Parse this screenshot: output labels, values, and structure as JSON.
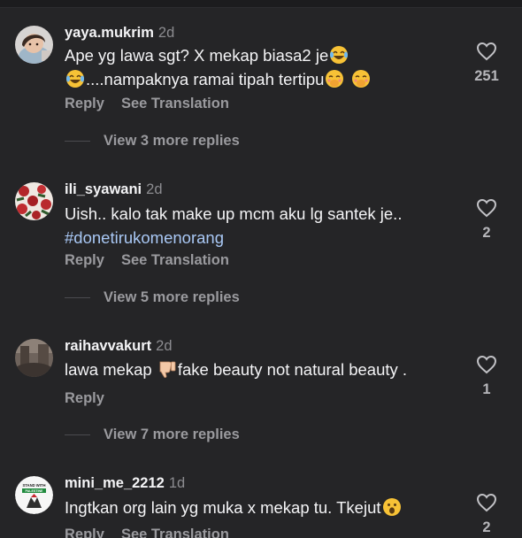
{
  "comments": [
    {
      "username": "yaya.mukrim",
      "time": "2d",
      "text_line1": "Ape yg lawa sgt? X mekap biasa2 je",
      "text_line2": "....nampaknya ramai tipah tertipu",
      "reply_label": "Reply",
      "translate_label": "See Translation",
      "like_count": "251",
      "more_replies": "View 3 more replies"
    },
    {
      "username": "ili_syawani",
      "time": "2d",
      "text_line1": "Uish.. kalo tak make up mcm aku lg santek je..",
      "hashtag": "#donetirukomenorang",
      "reply_label": "Reply",
      "translate_label": "See Translation",
      "like_count": "2",
      "more_replies": "View 5 more replies"
    },
    {
      "username": "raihavvakurt",
      "time": "2d",
      "text_before": "lawa mekap ",
      "text_after": "fake beauty not natural beauty .",
      "reply_label": "Reply",
      "like_count": "1",
      "more_replies": "View 7 more replies"
    },
    {
      "username": "mini_me_2212",
      "time": "1d",
      "text_line1": "Ingtkan org lain yg muka x mekap tu. Tkejut",
      "reply_label": "Reply",
      "translate_label": "See Translation",
      "like_count": "2",
      "avatar_text": "STAND WITH PALESTINE"
    }
  ],
  "icons": {
    "like": "heart-outline-icon",
    "emoji_laugh": "face-with-tears-of-joy-icon",
    "emoji_blush": "face-with-hand-over-mouth-icon",
    "emoji_thumb": "thumbs-down-icon",
    "emoji_surprise": "hushed-face-icon"
  },
  "colors": {
    "background": "#252527",
    "text": "#f4f4f6",
    "secondary": "#9a9a9e",
    "hashtag": "#a9c8f5"
  }
}
